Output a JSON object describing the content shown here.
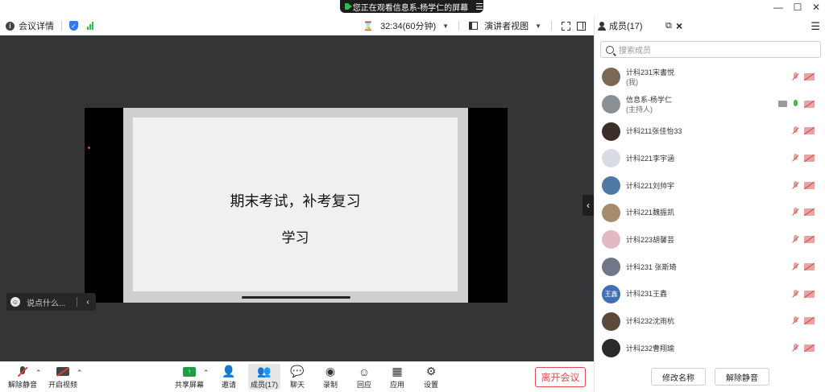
{
  "colors": {
    "accent": "#2b7cf6",
    "leave": "#e04b4b",
    "stage": "#343536",
    "active_share": "#2dbe4e"
  },
  "share_banner": {
    "text": "您正在观看信息系-杨学仁的屏幕",
    "menu_icon": "menu-icon"
  },
  "toolbar": {
    "meeting_info": "会议详情",
    "timer": "32:34(60分钟)",
    "view_mode": "演讲者视图"
  },
  "slide": {
    "line1": "期末考试，补考复习",
    "line2": "学习"
  },
  "chat": {
    "placeholder": "说点什么..."
  },
  "bottom": {
    "unmute": "解除静音",
    "start_video": "开启视频",
    "share_screen": "共享屏幕",
    "invite": "邀请",
    "members": "成员(17)",
    "chat": "聊天",
    "record": "录制",
    "reactions": "回应",
    "apps": "应用",
    "settings": "设置",
    "leave": "离开会议"
  },
  "panel": {
    "title": "成员(17)",
    "search_placeholder": "搜索成员",
    "rename": "修改名称",
    "unmute": "解除静音",
    "members": [
      {
        "name": "计科231宋書悦",
        "sub": "(我)",
        "avatar_color": "#7a6a55",
        "mic": "off"
      },
      {
        "name": "信息系-杨学仁",
        "sub": "(主持人)",
        "avatar_color": "#8a8f96",
        "mic": "on",
        "sharing": true
      },
      {
        "name": "计科211张佳怡33",
        "sub": "",
        "avatar_color": "#3c2d2a",
        "mic": "off"
      },
      {
        "name": "计科221李宇涵",
        "sub": "",
        "avatar_color": "#d9dce3",
        "mic": "off"
      },
      {
        "name": "计科221刘帅宇",
        "sub": "",
        "avatar_color": "#4d7aa6",
        "mic": "off"
      },
      {
        "name": "计科221魏振凯",
        "sub": "",
        "avatar_color": "#a58c6b",
        "mic": "off"
      },
      {
        "name": "计科223胡馨芸",
        "sub": "",
        "avatar_color": "#e3b9c4",
        "mic": "off"
      },
      {
        "name": "计科231 张斯琦",
        "sub": "",
        "avatar_color": "#6e7886",
        "mic": "off"
      },
      {
        "name": "计科231王鑫",
        "sub": "",
        "avatar_color": "#3f6fb5",
        "avatar_text": "王鑫",
        "mic": "off"
      },
      {
        "name": "计科232沈雨杭",
        "sub": "",
        "avatar_color": "#5b4a3a",
        "mic": "off"
      },
      {
        "name": "计科232曹翔瑜",
        "sub": "",
        "avatar_color": "#2a2a2a",
        "mic": "off"
      }
    ]
  }
}
